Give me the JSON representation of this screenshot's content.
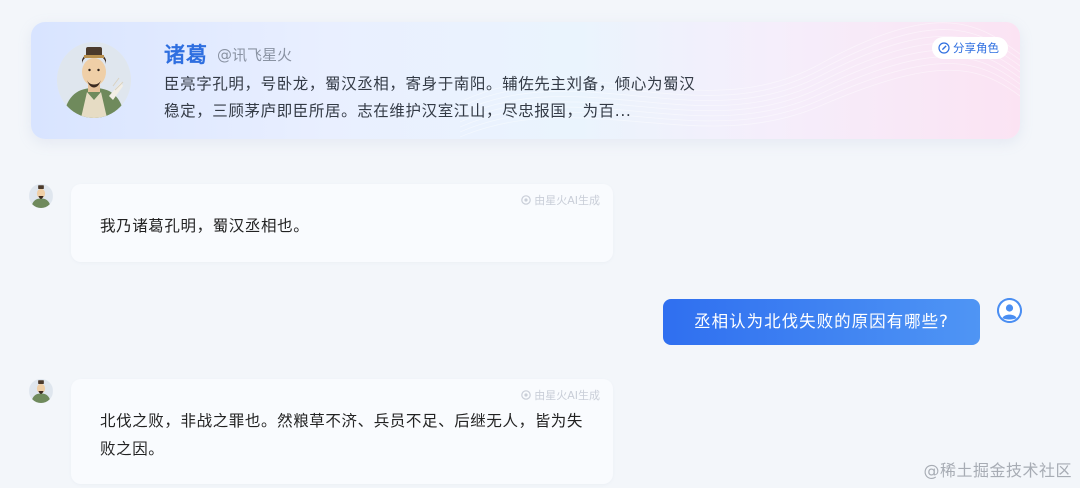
{
  "role": {
    "name": "诸葛",
    "handle": "@讯飞星火",
    "description": "臣亮字孔明，号卧龙，蜀汉丞相，寄身于南阳。辅佐先主刘备，倾心为蜀汉稳定，三顾茅庐即臣所居。志在维护汉室江山，尽忠报国，为百...",
    "share_label": "分享角色",
    "avatar_icon": "zhuge-liang-portrait",
    "accent_color": "#2f6fe0"
  },
  "ai_tag_label": "由星火AI生成",
  "messages": [
    {
      "sender": "bot",
      "text": "我乃诸葛孔明，蜀汉丞相也。"
    },
    {
      "sender": "user",
      "text": "丞相认为北伐失败的原因有哪些?"
    },
    {
      "sender": "bot",
      "text": "北伐之败，非战之罪也。然粮草不济、兵员不足、后继无人，皆为失败之因。"
    }
  ],
  "user_bubble_colors": [
    "#2f6ff0",
    "#4f95f4"
  ],
  "watermark": "@稀土掘金技术社区"
}
